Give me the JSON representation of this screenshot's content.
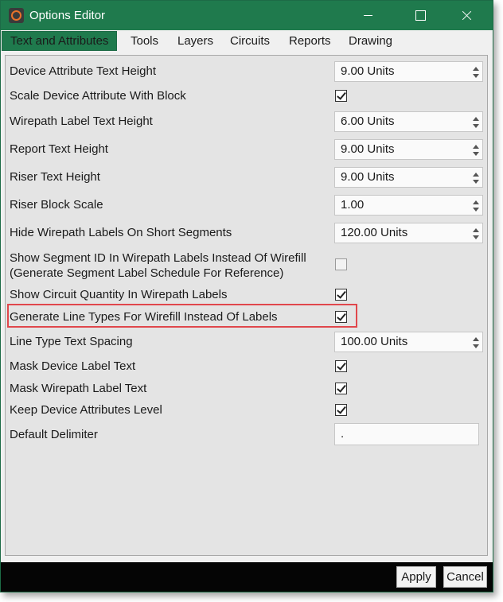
{
  "window": {
    "title": "Options Editor"
  },
  "tabs": [
    {
      "label": "Text and Attributes",
      "active": true
    },
    {
      "label": "Tools"
    },
    {
      "label": "Layers"
    },
    {
      "label": "Circuits"
    },
    {
      "label": "Reports"
    },
    {
      "label": "Drawing"
    }
  ],
  "settings": {
    "device_attribute_text_height": {
      "label": "Device Attribute Text Height",
      "value": "9.00 Units"
    },
    "scale_device_attribute_with_block": {
      "label": "Scale Device Attribute With Block",
      "checked": true
    },
    "wirepath_label_text_height": {
      "label": "Wirepath Label Text Height",
      "value": "6.00 Units"
    },
    "report_text_height": {
      "label": "Report Text Height",
      "value": "9.00 Units"
    },
    "riser_text_height": {
      "label": "Riser Text Height",
      "value": "9.00 Units"
    },
    "riser_block_scale": {
      "label": "Riser Block Scale",
      "value": "1.00"
    },
    "hide_wirepath_labels": {
      "label": "Hide Wirepath Labels On Short Segments",
      "value": "120.00 Units"
    },
    "show_segment_id": {
      "label_line1": "Show Segment ID In Wirepath Labels Instead Of Wirefill",
      "label_line2": "(Generate Segment Label Schedule For Reference)",
      "checked": false
    },
    "show_circuit_quantity": {
      "label": "Show Circuit Quantity In Wirepath Labels",
      "checked": true
    },
    "generate_line_types": {
      "label": "Generate Line Types For Wirefill Instead Of Labels",
      "checked": true
    },
    "line_type_text_spacing": {
      "label": "Line Type Text Spacing",
      "value": "100.00 Units"
    },
    "mask_device_label_text": {
      "label": "Mask Device Label Text",
      "checked": true
    },
    "mask_wirepath_label_text": {
      "label": "Mask Wirepath Label Text",
      "checked": true
    },
    "keep_device_attributes_level": {
      "label": "Keep Device Attributes Level",
      "checked": true
    },
    "default_delimiter": {
      "label": "Default Delimiter",
      "value": "."
    }
  },
  "buttons": {
    "apply": "Apply",
    "cancel": "Cancel"
  },
  "colors": {
    "titlebar": "#1f7a4d",
    "highlight": "#e0474c"
  }
}
